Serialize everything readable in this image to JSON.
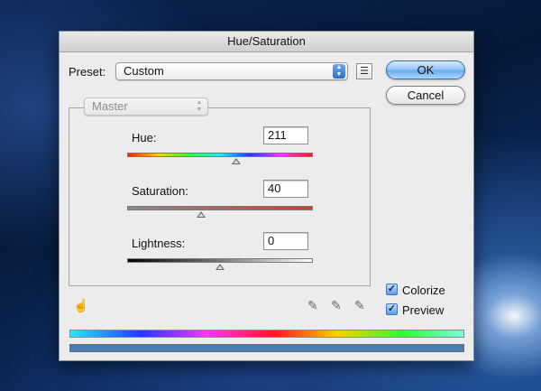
{
  "dialog": {
    "title": "Hue/Saturation",
    "preset_label": "Preset:",
    "preset_value": "Custom",
    "preset_options_icon": "list-options-icon",
    "ok_label": "OK",
    "cancel_label": "Cancel",
    "channel_value": "Master",
    "hue": {
      "label": "Hue:",
      "value": "211"
    },
    "saturation": {
      "label": "Saturation:",
      "value": "40"
    },
    "lightness": {
      "label": "Lightness:",
      "value": "0"
    },
    "colorize_label": "Colorize",
    "preview_label": "Preview",
    "colorize_checked": true,
    "preview_checked": true,
    "icons": {
      "hand": "hand-adjust-icon",
      "eyedropper": "eyedropper-icon",
      "eyedropper_plus": "eyedropper-plus-icon",
      "eyedropper_minus": "eyedropper-minus-icon"
    },
    "colors": {
      "accent": "#6aaaf0",
      "result_bar": "#4b7eb8"
    }
  }
}
